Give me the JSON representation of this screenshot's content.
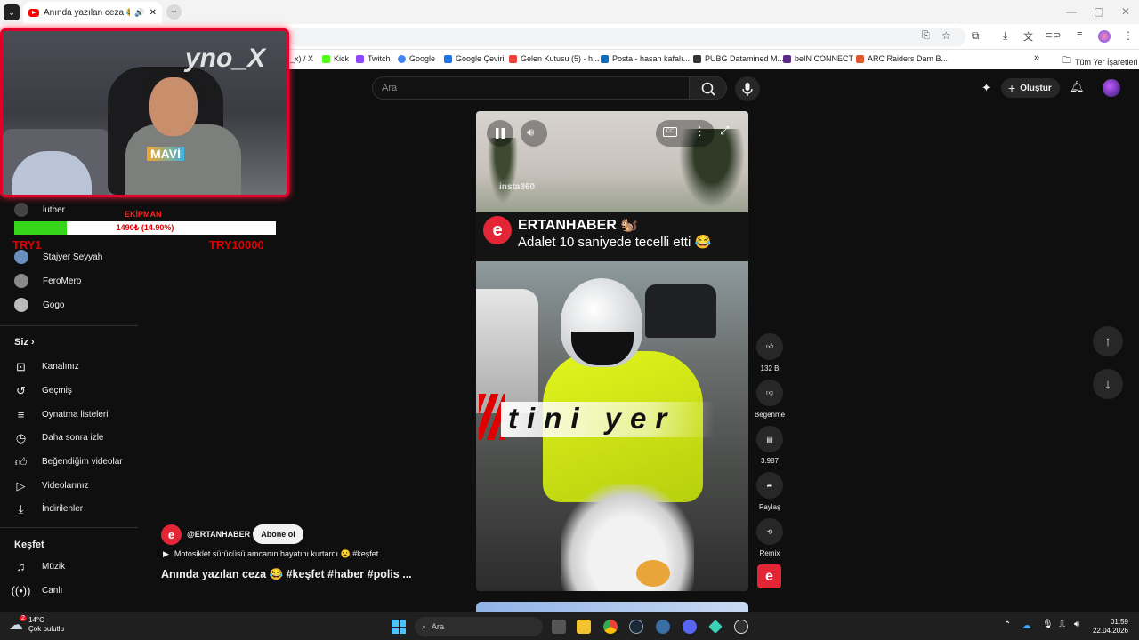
{
  "browser": {
    "tab_title": "Anında yazılan ceza 😂 #k",
    "window_controls": [
      "—",
      "▢",
      "✕"
    ],
    "bookmarks": [
      {
        "label": "_x) / X",
        "color": "#111111"
      },
      {
        "label": "Kick",
        "color": "#53fc18"
      },
      {
        "label": "Twitch",
        "color": "#9146ff"
      },
      {
        "label": "Google",
        "color": "#4285f4"
      },
      {
        "label": "Google Çeviri",
        "color": "#1a73e8"
      },
      {
        "label": "Gelen Kutusu (5) - h...",
        "color": "#ea4335"
      },
      {
        "label": "Posta - hasan kafalı...",
        "color": "#0f6cbd"
      },
      {
        "label": "PUBG Datamined M...",
        "color": "#333333"
      },
      {
        "label": "beIN CONNECT",
        "color": "#5b2a86"
      },
      {
        "label": "ARC Raiders Dam B...",
        "color": "#e4572e"
      }
    ],
    "bookmarks_more": "»",
    "all_bookmarks": "Tüm Yer İşaretleri"
  },
  "header": {
    "search_placeholder": "Ara",
    "create_label": "Oluştur"
  },
  "sidebar": {
    "subscriptions_top": [
      {
        "label": "luther"
      }
    ],
    "subscriptions": [
      {
        "label": "Stajyer Seyyah",
        "avatar_color": "#6a8fbf"
      },
      {
        "label": "FeroMero",
        "avatar_color": "#8a8a8a"
      },
      {
        "label": "Gogo",
        "avatar_color": "#bbbbbb"
      }
    ],
    "you_heading": "Siz",
    "you_items": [
      {
        "label": "Kanalınız",
        "icon": "channel-icon"
      },
      {
        "label": "Geçmiş",
        "icon": "history-icon"
      },
      {
        "label": "Oynatma listeleri",
        "icon": "playlists-icon"
      },
      {
        "label": "Daha sonra izle",
        "icon": "watch-later-icon"
      },
      {
        "label": "Beğendiğim videolar",
        "icon": "liked-icon"
      },
      {
        "label": "Videolarınız",
        "icon": "your-videos-icon"
      },
      {
        "label": "İndirilenler",
        "icon": "downloads-icon"
      }
    ],
    "explore_heading": "Keşfet",
    "explore_items": [
      {
        "label": "Müzik",
        "icon": "music-icon"
      },
      {
        "label": "Canlı",
        "icon": "live-icon"
      }
    ]
  },
  "donation": {
    "title": "EKİPMAN",
    "progress_text": "1490₺ (14.90%)",
    "progress_fraction": 0.149,
    "min_label": "TRY1",
    "max_label": "TRY10000"
  },
  "webcam": {
    "overlay_text": "yno_X",
    "shirt_text": "MAVİ"
  },
  "short": {
    "watermark": "insta360",
    "channel_banner": "ERTANHABER 🐿️",
    "banner_caption": "Adalet 10 saniyede tecelli etti 😂",
    "overlay_text": "tini yer",
    "channel_handle": "@ERTANHABER",
    "subscribe_label": "Abone ol",
    "description": "Motosiklet sürücüsü amcanın hayatını kurtardı 😮 #keşfet",
    "title": "Anında yazılan ceza 😂 #keşfet #haber #polis ...",
    "actions": [
      {
        "label": "132 B",
        "icon": "like-icon"
      },
      {
        "label": "Beğenme",
        "icon": "dislike-icon"
      },
      {
        "label": "3.987",
        "icon": "comment-icon"
      },
      {
        "label": "Paylaş",
        "icon": "share-icon"
      },
      {
        "label": "Remix",
        "icon": "remix-icon"
      }
    ]
  },
  "taskbar": {
    "weather_temp": "14°C",
    "weather_desc": "Çok bulutlu",
    "weather_badge": "2",
    "search_placeholder": "Ara",
    "time": "01:59",
    "date": "22.04.2026"
  }
}
